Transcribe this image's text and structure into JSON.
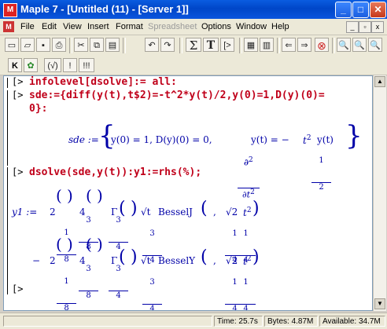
{
  "window": {
    "title": "Maple 7 - [Untitled (11) - [Server 1]]",
    "app_icon": "maple-leaf-icon"
  },
  "menubar": {
    "items": [
      {
        "label": "File",
        "enabled": true
      },
      {
        "label": "Edit",
        "enabled": true
      },
      {
        "label": "View",
        "enabled": true
      },
      {
        "label": "Insert",
        "enabled": true
      },
      {
        "label": "Format",
        "enabled": true
      },
      {
        "label": "Spreadsheet",
        "enabled": false
      },
      {
        "label": "Options",
        "enabled": true
      },
      {
        "label": "Window",
        "enabled": true
      },
      {
        "label": "Help",
        "enabled": true
      }
    ]
  },
  "toolbar": {
    "icons": [
      "new-icon",
      "open-icon",
      "save-icon",
      "print-icon",
      "cut-icon",
      "copy-icon",
      "paste-icon",
      "undo-icon",
      "redo-icon",
      "sigma-icon",
      "text-icon",
      "prompt-icon",
      "indent-icon",
      "outdent-icon",
      "back-icon",
      "forward-icon",
      "stop-icon",
      "zoom-in-icon",
      "zoom-out-icon",
      "zoom-fit-icon"
    ],
    "sigma": "Σ",
    "text": "T",
    "prompt": "[>"
  },
  "toolbar2": {
    "k_label": "K",
    "bang1": "!",
    "bang3": "!!!",
    "paren": "(√)"
  },
  "worksheet": {
    "lines": [
      {
        "prompt": "[>",
        "code": "infolevel[dsolve]:= all:"
      },
      {
        "prompt": "[>",
        "code": "sde:={diff(y(t),t$2)=-t^2*y(t)/2,y(0)=1,D(y)(0)="
      },
      {
        "prompt": "",
        "code": "0}:"
      },
      {
        "prompt": "[>",
        "code": "dsolve(sde,y(t)):y1:=rhs(%);"
      },
      {
        "prompt": "[>",
        "code": ""
      }
    ],
    "output_sde": {
      "lhs": "sde :=",
      "part1": "y(0) = 1, D(y)(0) = 0,",
      "d": "∂",
      "sq": "2",
      "dt": "∂t",
      "part2": "y(t) = −",
      "half_num": "1",
      "half_den": "2",
      "part3": "t",
      "part4": "y(t)"
    },
    "output_y1": {
      "lhs": "y1 :=",
      "frac_1_8_num": "1",
      "frac_1_8_den": "8",
      "two": "2",
      "three_eighths_num": "3",
      "three_eighths_den": "8",
      "four": "4",
      "three_quarters_num": "3",
      "three_quarters_den": "4",
      "gamma": "Γ",
      "sqrt_t": "√t",
      "besselj": "BesselJ",
      "bessely": "BesselY",
      "quarter_num": "1",
      "quarter_den": "4",
      "sqrt2": "√2",
      "t2": "t",
      "minus": "−"
    }
  },
  "statusbar": {
    "time": "Time: 25.7s",
    "bytes": "Bytes: 4.87M",
    "available": "Available: 34.7M"
  }
}
